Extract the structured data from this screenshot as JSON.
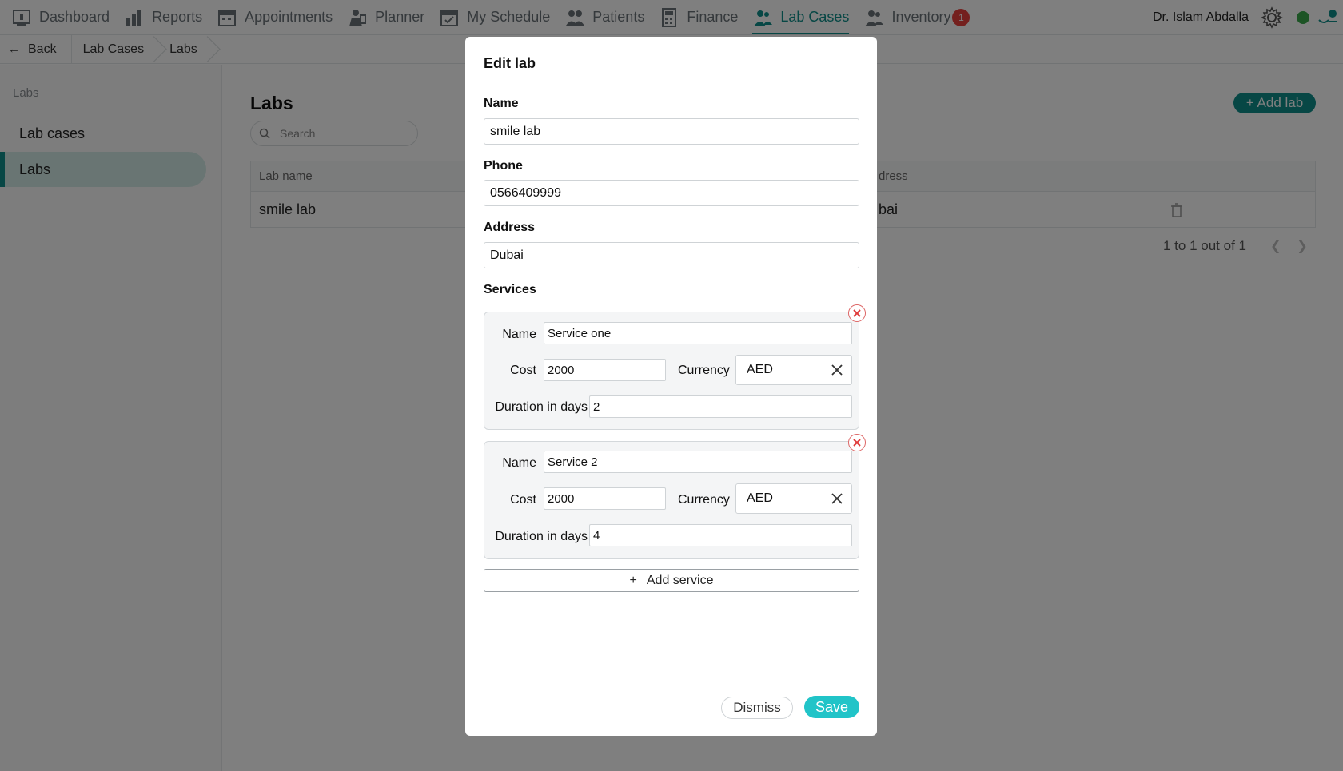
{
  "nav": {
    "items": [
      {
        "label": "Dashboard",
        "icon": "dashboard-icon"
      },
      {
        "label": "Reports",
        "icon": "reports-icon"
      },
      {
        "label": "Appointments",
        "icon": "appointments-icon"
      },
      {
        "label": "Planner",
        "icon": "planner-icon"
      },
      {
        "label": "My Schedule",
        "icon": "schedule-icon"
      },
      {
        "label": "Patients",
        "icon": "patients-icon"
      },
      {
        "label": "Finance",
        "icon": "finance-icon"
      },
      {
        "label": "Lab Cases",
        "icon": "lab-cases-icon"
      },
      {
        "label": "Inventory",
        "icon": "inventory-icon"
      }
    ],
    "active": "Lab Cases",
    "inventory_badge": "1",
    "user_name": "Dr. Islam Abdalla"
  },
  "breadcrumb": {
    "back_label": "Back",
    "items": [
      "Lab Cases",
      "Labs"
    ]
  },
  "sidebar": {
    "heading": "Labs",
    "items": [
      {
        "label": "Lab cases"
      },
      {
        "label": "Labs"
      }
    ]
  },
  "main": {
    "title": "Labs",
    "search_placeholder": "Search",
    "add_button": "+ Add lab",
    "table": {
      "columns": [
        "Lab name",
        "dress"
      ],
      "rows": [
        {
          "name": "smile lab",
          "address": "bai"
        }
      ]
    },
    "pagination": "1 to 1 out of 1"
  },
  "modal": {
    "title": "Edit lab",
    "name_label": "Name",
    "name_value": "smile lab",
    "phone_label": "Phone",
    "phone_value": "0566409999",
    "address_label": "Address",
    "address_value": "Dubai",
    "services_label": "Services",
    "service_field_labels": {
      "name": "Name",
      "cost": "Cost",
      "currency": "Currency",
      "duration": "Duration in days"
    },
    "services": [
      {
        "name": "Service one",
        "cost": "2000",
        "currency": "AED",
        "duration": "2"
      },
      {
        "name": "Service 2",
        "cost": "2000",
        "currency": "AED",
        "duration": "4"
      }
    ],
    "add_service_label": "Add service",
    "dismiss_label": "Dismiss",
    "save_label": "Save"
  },
  "colors": {
    "accent": "#0f8f8a",
    "save": "#21c4c8",
    "badge": "#e8403c",
    "status_online": "#3aa94b"
  }
}
